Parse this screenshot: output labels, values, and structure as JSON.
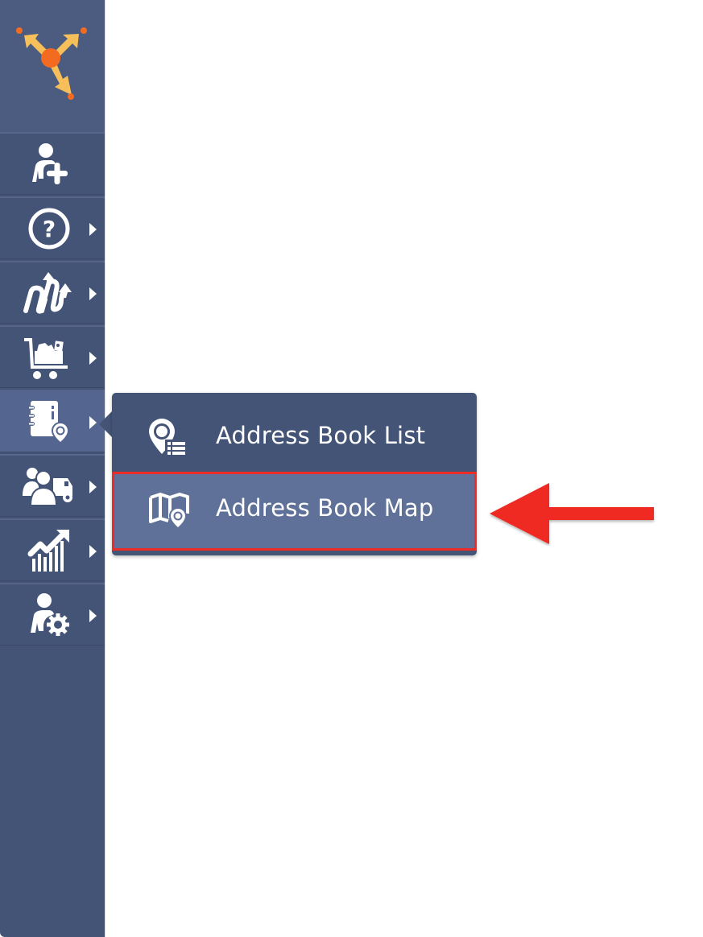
{
  "app": {
    "logo_icon": "route-branch-logo-icon",
    "accent_color": "#F5A623",
    "sidebar_bg": "#445477"
  },
  "sidebar": {
    "items": [
      {
        "id": "add-user",
        "icon": "user-plus-icon",
        "has_submenu": false,
        "active": false
      },
      {
        "id": "help",
        "icon": "question-circle-icon",
        "has_submenu": true,
        "active": false
      },
      {
        "id": "routes",
        "icon": "routes-arrows-icon",
        "has_submenu": true,
        "active": false
      },
      {
        "id": "orders",
        "icon": "shopping-cart-icon",
        "has_submenu": true,
        "active": false
      },
      {
        "id": "address-book",
        "icon": "address-book-pin-icon",
        "has_submenu": true,
        "active": true
      },
      {
        "id": "team-vehicles",
        "icon": "team-vehicle-icon",
        "has_submenu": true,
        "active": false
      },
      {
        "id": "analytics",
        "icon": "growth-chart-icon",
        "has_submenu": true,
        "active": false
      },
      {
        "id": "account-settings",
        "icon": "user-gear-icon",
        "has_submenu": true,
        "active": false
      }
    ]
  },
  "flyout": {
    "items": [
      {
        "label": "Address Book List",
        "icon": "pin-list-icon",
        "highlighted": false
      },
      {
        "label": "Address Book Map",
        "icon": "map-pin-icon",
        "highlighted": true
      }
    ]
  },
  "annotation": {
    "arrow_color": "#EE2B24",
    "highlight_color": "#EE2B24",
    "points_to": "Address Book Map"
  }
}
